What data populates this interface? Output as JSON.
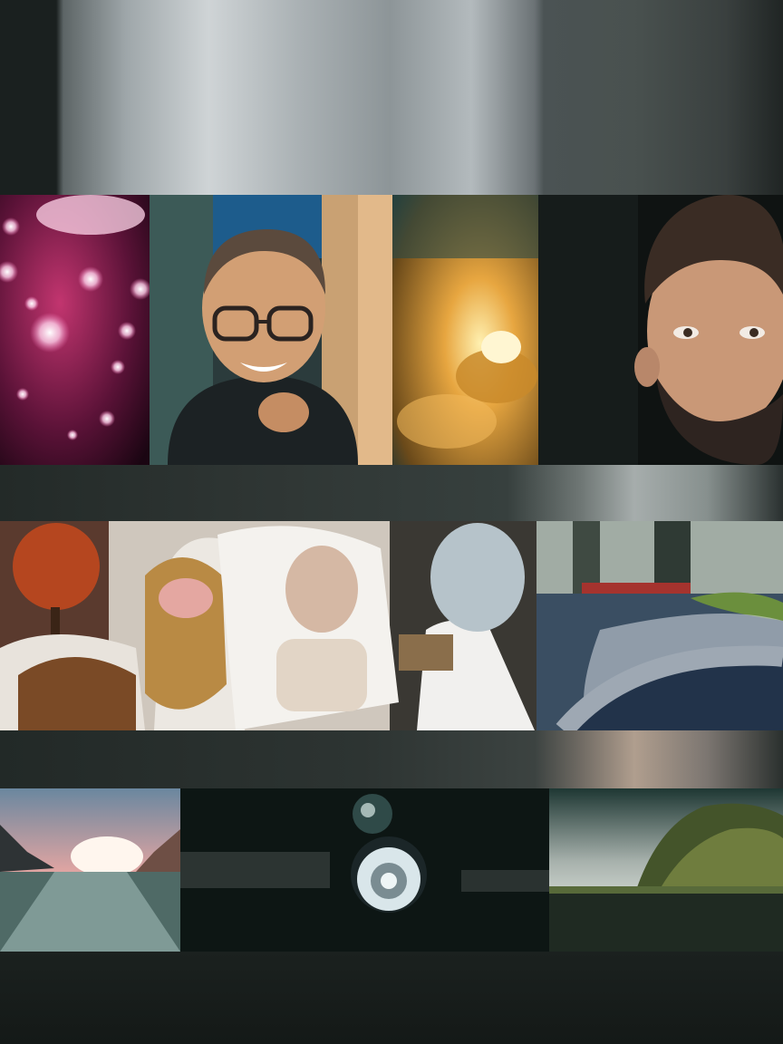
{
  "collage": {
    "rows": [
      [
        "pink-bokeh",
        "smiling-person-glasses",
        "golden-bokeh-lamp",
        "bearded-man-portrait"
      ],
      [
        "white-costumed-figures",
        "road-with-hedge"
      ],
      [
        "highway-sunset",
        "dark-lens-scene",
        "grass-landscape"
      ]
    ]
  },
  "colors": {
    "background": "#151a18",
    "pink_bokeh": "#c2356f",
    "golden_bokeh": "#e7a640",
    "sky_pink": "#e9a7a2"
  }
}
